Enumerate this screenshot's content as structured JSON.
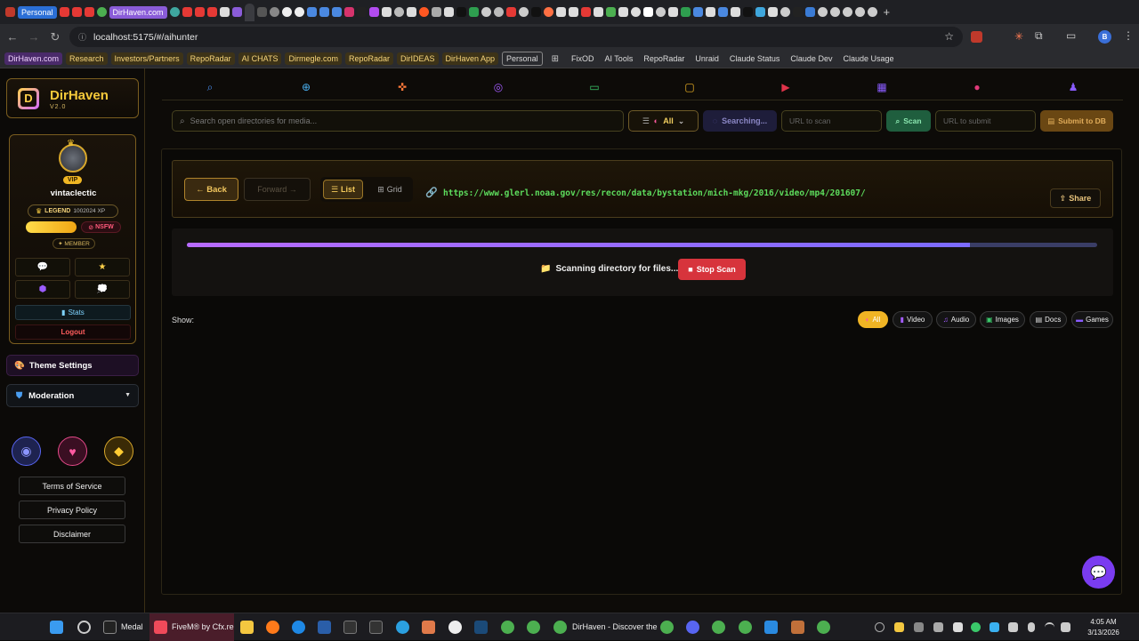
{
  "browser": {
    "tabs": [
      "Personal",
      "DirHaven.com"
    ],
    "address": "localhost:5175/#/aihunter",
    "profile_initial": "B",
    "bookmarks": [
      "DirHaven.com",
      "Research",
      "Investors/Partners",
      "RepoRadar",
      "AI CHATS",
      "Dirmegle.com",
      "RepoRadar",
      "DirIDEAS",
      "DirHaven App",
      "Personal",
      "FixOD",
      "AI Tools",
      "RepoRadar",
      "Unraid",
      "Claude Status",
      "Claude Dev",
      "Claude Usage"
    ]
  },
  "sidebar": {
    "logo_title": "DirHaven",
    "logo_version": "V2.0",
    "badge_vip": "VIP",
    "username": "vintaclectic",
    "legend_title": "LEGEND",
    "legend_xp": "1002024 XP",
    "nsfw_label": "NSFW",
    "member_label": "✦ MEMBER",
    "stats_label": "Stats",
    "logout_label": "Logout",
    "theme_settings_label": "Theme Settings",
    "moderation_label": "Moderation",
    "footer_links": [
      "Terms of Service",
      "Privacy Policy",
      "Disclaimer"
    ]
  },
  "toolbar": {
    "search_placeholder": "Search open directories for media...",
    "filter_label": "All",
    "searching_label": "Searching...",
    "scan_url_placeholder": "URL to scan",
    "scan_label": "Scan",
    "submit_url_placeholder": "URL to submit",
    "submit_label": "Submit to DB"
  },
  "browser_panel": {
    "back_label": "← Back",
    "forward_label": "Forward →",
    "list_label": "List",
    "grid_label": "Grid",
    "current_url": "https://www.glerl.noaa.gov/res/recon/data/bystation/mich-mkg/2016/video/mp4/201607/",
    "share_label": "Share",
    "progress": 0.86,
    "scan_status": "Scanning directory for files...",
    "stop_label": "Stop Scan",
    "show_label": "Show:",
    "filters": [
      "All",
      "Video",
      "Audio",
      "Images",
      "Docs",
      "Games"
    ]
  },
  "taskbar": {
    "apps": [
      "Medal",
      "FiveM® by Cfx.re",
      "DirHaven - Discover the"
    ],
    "time": "4:05 AM",
    "date": "3/13/2026"
  }
}
